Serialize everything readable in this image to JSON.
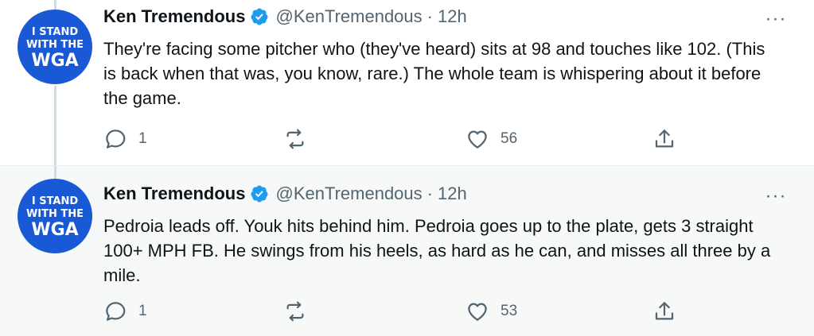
{
  "tweets": [
    {
      "author_name": "Ken Tremendous",
      "handle": "@KenTremendous",
      "separator": "·",
      "time": "12h",
      "more": "···",
      "avatar": {
        "line1": "I STAND",
        "line2": "WITH THE",
        "line3": "WGA",
        "bg": "#1a59d6"
      },
      "text": "They're facing some pitcher who (they've heard) sits at 98 and touches like 102. (This is back when that was, you know, rare.) The whole team is whispering about it before the game.",
      "replies": "1",
      "retweets": "",
      "likes": "56"
    },
    {
      "author_name": "Ken Tremendous",
      "handle": "@KenTremendous",
      "separator": "·",
      "time": "12h",
      "more": "···",
      "avatar": {
        "line1": "I STAND",
        "line2": "WITH THE",
        "line3": "WGA",
        "bg": "#1a59d6"
      },
      "text": "Pedroia leads off. Youk hits behind him. Pedroia goes up to the plate, gets 3 straight 100+ MPH FB. He swings from his heels, as hard as he can, and misses all three by a mile.",
      "replies": "1",
      "retweets": "",
      "likes": "53"
    }
  ],
  "colors": {
    "verified": "#1d9bf0",
    "muted": "#536471",
    "text": "#0f1419"
  },
  "icons": [
    "verified-badge-icon",
    "reply-icon",
    "retweet-icon",
    "like-icon",
    "share-icon",
    "more-icon"
  ]
}
